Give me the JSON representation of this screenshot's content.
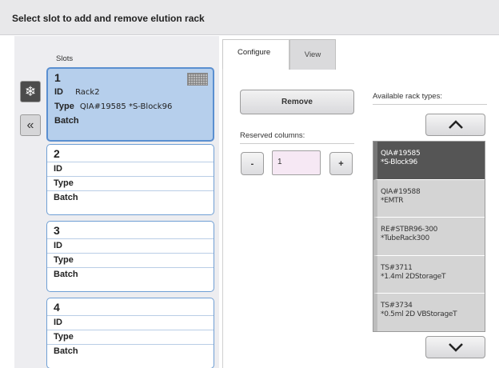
{
  "header": {
    "title": "Select slot to add and remove elution rack"
  },
  "slots_label": "Slots",
  "side_buttons": {
    "snow_glyph": "❄",
    "collapse_glyph": "«"
  },
  "field_labels": {
    "id": "ID",
    "type": "Type",
    "batch": "Batch"
  },
  "slots": [
    {
      "number": "1",
      "id": "Rack2",
      "type": "QIA#19585 *S-Block96",
      "batch": "",
      "selected": true
    },
    {
      "number": "2",
      "id": "",
      "type": "",
      "batch": "",
      "selected": false
    },
    {
      "number": "3",
      "id": "",
      "type": "",
      "batch": "",
      "selected": false
    },
    {
      "number": "4",
      "id": "",
      "type": "",
      "batch": "",
      "selected": false
    }
  ],
  "tabs": [
    {
      "label": "Configure",
      "active": true
    },
    {
      "label": "View",
      "active": false
    }
  ],
  "configure": {
    "remove_label": "Remove",
    "reserved_columns_label": "Reserved columns:",
    "minus_label": "-",
    "plus_label": "+",
    "reserved_columns_value": "1"
  },
  "available": {
    "label": "Available rack types:",
    "racks": [
      {
        "line1": "QIA#19585",
        "line2": "*S-Block96",
        "selected": true
      },
      {
        "line1": "QIA#19588",
        "line2": "*EMTR",
        "selected": false
      },
      {
        "line1": "RE#STBR96-300",
        "line2": "*TubeRack300",
        "selected": false
      },
      {
        "line1": "TS#3711",
        "line2": "*1.4ml 2DStorageT",
        "selected": false
      },
      {
        "line1": "TS#3734",
        "line2": "*0.5ml 2D VBStorageT",
        "selected": false
      }
    ]
  },
  "colors": {
    "header_bg": "#e8e8ea",
    "slot_border": "#6f9fd4",
    "slot_selected_bg": "#b6cfec",
    "rack_selected_bg": "#555555",
    "reserved_field_bg": "#f6e8f4"
  }
}
